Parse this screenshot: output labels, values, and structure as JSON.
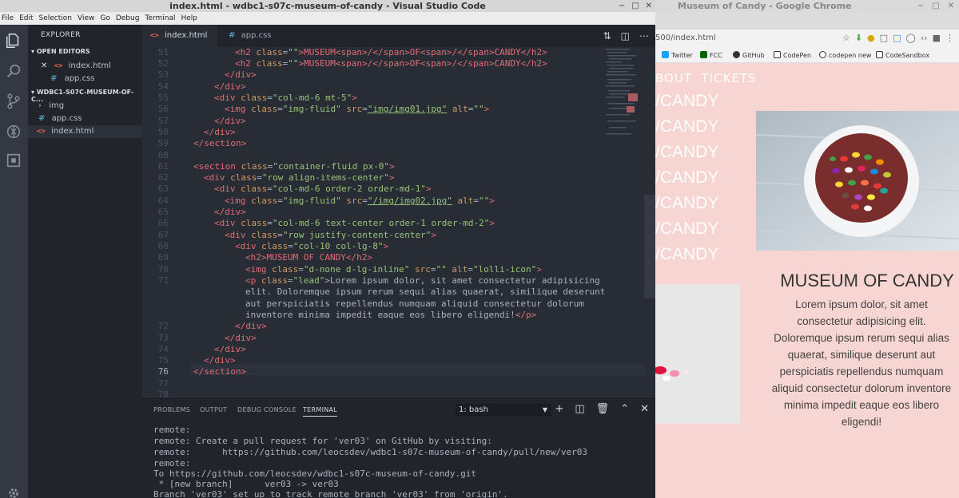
{
  "vscode": {
    "title": "index.html - wdbc1-s07c-museum-of-candy - Visual Studio Code",
    "menu": [
      "File",
      "Edit",
      "Selection",
      "View",
      "Go",
      "Debug",
      "Terminal",
      "Help"
    ],
    "explorer_title": "EXPLORER",
    "open_editors_label": "OPEN EDITORS",
    "open_editors": [
      "index.html",
      "app.css"
    ],
    "project_label": "WDBC1-S07C-MUSEUM-OF-C...",
    "files": [
      "img",
      "app.css",
      "index.html"
    ],
    "tabs": [
      "index.html",
      "app.css"
    ],
    "line_numbers": [
      "51",
      "52",
      "53",
      "54",
      "55",
      "56",
      "57",
      "58",
      "59",
      "60",
      "61",
      "62",
      "63",
      "64",
      "65",
      "66",
      "67",
      "68",
      "69",
      "70",
      "71",
      "",
      "",
      "",
      "72",
      "73",
      "74",
      "75",
      "76",
      "77",
      "78"
    ],
    "current_line": "76",
    "panel_tabs": [
      "PROBLEMS",
      "OUTPUT",
      "DEBUG CONSOLE",
      "TERMINAL"
    ],
    "terminal_select": "1: bash",
    "terminal_lines": [
      "remote:",
      "remote: Create a pull request for 'ver03' on GitHub by visiting:",
      "remote:      https://github.com/leocsdev/wdbc1-s07c-museum-of-candy/pull/new/ver03",
      "remote:",
      "To https://github.com/leocsdev/wdbc1-s07c-museum-of-candy.git",
      " * [new branch]      ver03 -> ver03",
      "Branch 'ver03' set up to track remote branch 'ver03' from 'origin'."
    ]
  },
  "code": {
    "l51": {
      "t1": "<h2 ",
      "a1": "class",
      "s1": "\"\"",
      "t2": ">MUSEUM<span>/</span>OF<span>/</span>CANDY</h2>"
    },
    "l52": {
      "t1": "<h2 ",
      "a1": "class",
      "s1": "\"\"",
      "t2": ">MUSEUM<span>/</span>OF<span>/</span>CANDY</h2>"
    },
    "l53": "</div>",
    "l54": "</div>",
    "l55": {
      "t1": "<div ",
      "a1": "class",
      "s1": "\"col-md-6 mt-5\"",
      "t2": ">"
    },
    "l56": {
      "t1": "<img ",
      "a1": "class",
      "s1": "\"img-fluid\"",
      "a2": "src",
      "s2": "\"img/img01.jpg\"",
      "a3": "alt",
      "s3": "\"\"",
      "t2": ">"
    },
    "l57": "</div>",
    "l58": "</div>",
    "l59": "</section>",
    "l61": {
      "t1": "<section ",
      "a1": "class",
      "s1": "\"container-fluid px-0\"",
      "t2": ">"
    },
    "l62": {
      "t1": "<div ",
      "a1": "class",
      "s1": "\"row align-items-center\"",
      "t2": ">"
    },
    "l63": {
      "t1": "<div ",
      "a1": "class",
      "s1": "\"col-md-6 order-2 order-md-1\"",
      "t2": ">"
    },
    "l64": {
      "t1": "<img ",
      "a1": "class",
      "s1": "\"img-fluid\"",
      "a2": "src",
      "s2": "\"/img/img02.jpg\"",
      "a3": "alt",
      "s3": "\"\"",
      "t2": ">"
    },
    "l65": "</div>",
    "l66": {
      "t1": "<div ",
      "a1": "class",
      "s1": "\"col-md-6 text-center order-1 order-md-2\"",
      "t2": ">"
    },
    "l67": {
      "t1": "<div ",
      "a1": "class",
      "s1": "\"row justify-content-center\"",
      "t2": ">"
    },
    "l68": {
      "t1": "<div ",
      "a1": "class",
      "s1": "\"col-10 col-lg-8\"",
      "t2": ">"
    },
    "l69": "<h2>MUSEUM OF CANDY</h2>",
    "l70": {
      "t1": "<img ",
      "a1": "class",
      "s1": "\"d-none d-lg-inline\"",
      "a2": "src",
      "s2": "\"\"",
      "a3": "alt",
      "s3": "\"lolli-icon\"",
      "t2": ">"
    },
    "l71a": {
      "t1": "<p ",
      "a1": "class",
      "s1": "\"lead\"",
      "txt": ">Lorem ipsum dolor, sit amet consectetur adipisicing"
    },
    "l71b": "elit. Doloremque ipsum rerum sequi alias quaerat, similique deserunt",
    "l71c": "aut perspiciatis repellendus numquam aliquid consectetur dolorum",
    "l71d": {
      "txt": "inventore minima impedit eaque eos libero eligendi!",
      "t2": "</p>"
    },
    "l72": "</div>",
    "l73": "</div>",
    "l74": "</div>",
    "l75": "</div>",
    "l76": "</section>"
  },
  "chrome": {
    "title": "Museum of Candy - Google Chrome",
    "url": "500/index.html",
    "bookmarks": [
      "Twitter",
      "FCC",
      "GitHub",
      "CodePen",
      "codepen new",
      "CodeSandbox"
    ],
    "site": {
      "nav": "BOUT  TICKETS",
      "candy_lines": [
        "/CANDY",
        "/CANDY",
        "/CANDY",
        "/CANDY",
        "/CANDY",
        "/CANDY",
        "/CANDY"
      ],
      "heading": "MUSEUM OF CANDY",
      "lead": "Lorem ipsum dolor, sit amet consectetur adipisicing elit. Doloremque ipsum rerum sequi alias quaerat, similique deserunt aut perspiciatis repellendus numquam aliquid consectetur dolorum inventore minima impedit eaque eos libero eligendi!"
    }
  }
}
